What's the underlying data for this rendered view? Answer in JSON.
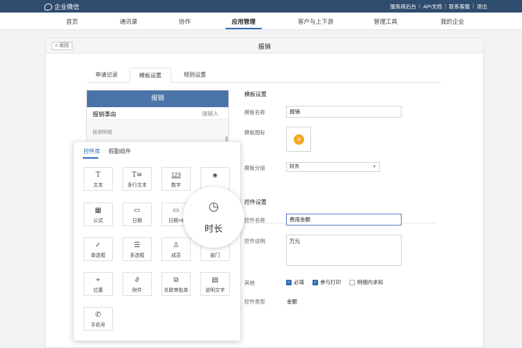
{
  "topbar": {
    "brand": "企业微信",
    "links": [
      "服务商后台",
      "API文档",
      "联系客服",
      "退出"
    ]
  },
  "nav": {
    "items": [
      "首页",
      "通讯录",
      "协作",
      "应用管理",
      "客户与上下游",
      "管理工具",
      "我的企业"
    ],
    "active": "应用管理"
  },
  "panel": {
    "back_label": "返回",
    "title": "报销",
    "tabs": [
      "申请记录",
      "模板设置",
      "规则设置"
    ],
    "active_tab": "模板设置"
  },
  "preview": {
    "header": "报销",
    "row_label": "报销事由",
    "row_placeholder": "请输入",
    "desc_label": "报销明细"
  },
  "library": {
    "tabs": [
      "控件库",
      "假勤组件"
    ],
    "controls": [
      {
        "icon": "T",
        "icon_name": "text-icon",
        "label": "文本"
      },
      {
        "icon": "T≡",
        "icon_name": "multiline-text-icon",
        "label": "多行文本"
      },
      {
        "icon": "123",
        "icon_name": "number-icon",
        "label": "数字"
      },
      {
        "icon": "◉",
        "icon_name": "amount-icon",
        "label": ""
      },
      {
        "icon": "▦",
        "icon_name": "formula-icon",
        "label": "公式"
      },
      {
        "icon": "▭",
        "icon_name": "date-icon",
        "label": "日期"
      },
      {
        "icon": "▭",
        "icon_name": "date-range-icon",
        "label": "日期+8"
      },
      {
        "icon": "◷",
        "icon_name": "duration-icon",
        "label": ""
      },
      {
        "icon": "✓",
        "icon_name": "single-select-icon",
        "label": "单选框"
      },
      {
        "icon": "☰",
        "icon_name": "multi-select-icon",
        "label": "多选框"
      },
      {
        "icon": "♙",
        "icon_name": "member-icon",
        "label": "成员"
      },
      {
        "icon": "",
        "icon_name": "department-icon",
        "label": "部门"
      },
      {
        "icon": "⌖",
        "icon_name": "location-icon",
        "label": "位置"
      },
      {
        "icon": "∂",
        "icon_name": "attachment-icon",
        "label": "附件"
      },
      {
        "icon": "⧉",
        "icon_name": "related-form-icon",
        "label": "关联审批单"
      },
      {
        "icon": "▤",
        "icon_name": "description-icon",
        "label": "说明文字"
      },
      {
        "icon": "✆",
        "icon_name": "phone-icon",
        "label": "手机号"
      }
    ],
    "magnified": {
      "icon": "◷",
      "icon_name": "duration-icon",
      "label": "时长"
    }
  },
  "template_settings": {
    "section_title": "模板设置",
    "name_label": "模板名称",
    "name_value": "报销",
    "icon_label": "模板图标",
    "icon_glyph": "¥",
    "icon_color": "#f6a623",
    "group_label": "模板分组",
    "group_value": "财务"
  },
  "control_settings": {
    "section_title": "控件设置",
    "name_label": "控件名称",
    "name_value": "费用金额",
    "desc_label": "控件说明",
    "desc_value": "万元",
    "other_label": "其他",
    "options": [
      {
        "label": "必填",
        "checked": true
      },
      {
        "label": "参与打印",
        "checked": true
      },
      {
        "label": "明细内求和",
        "checked": false
      }
    ],
    "type_label": "控件类型",
    "type_value": "金额"
  },
  "colors": {
    "topbar": "#2f4b6d",
    "accent": "#2f6ab5",
    "preview_header": "#4a74a8"
  }
}
